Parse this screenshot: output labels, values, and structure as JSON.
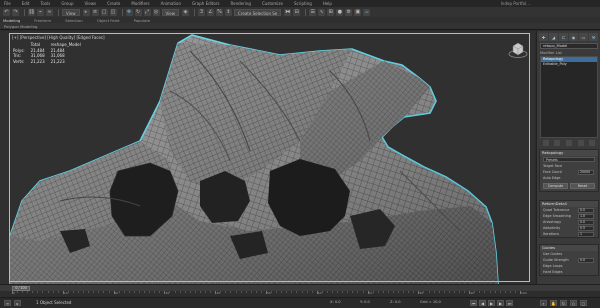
{
  "window": {
    "title": "Indep Portfol..."
  },
  "menu": [
    "File",
    "Edit",
    "Tools",
    "Group",
    "Views",
    "Create",
    "Modifiers",
    "Animation",
    "Graph Editors",
    "Rendering",
    "Customize",
    "Scripting",
    "Help"
  ],
  "toolbar": {
    "selection_set": "Create Selection Se",
    "view_mode": "View"
  },
  "ribbon": {
    "tabs": [
      "Modeling",
      "Freeform",
      "Selection",
      "Object Paint",
      "Populate"
    ],
    "sub_label": "Polygon Modeling"
  },
  "viewport": {
    "label": "[+] [Perspective] [High Quality] [Edged Faces]",
    "stats": {
      "headers": [
        "",
        "Total",
        "reshape_Model"
      ],
      "rows": [
        [
          "Polys:",
          "21,484",
          "21,484"
        ],
        [
          "Tris:",
          "31,068",
          "31,068"
        ],
        [
          "Verts:",
          "21,223",
          "21,223"
        ]
      ]
    }
  },
  "command_panel": {
    "object_name": "retopo_Model",
    "modifier_list_label": "Modifier List",
    "stack": [
      {
        "label": "Retopology",
        "selected": true
      },
      {
        "label": "Editable_Poly",
        "selected": false
      }
    ],
    "retopology": {
      "title": "Retopology",
      "preset": "Presets",
      "target_label": "Target Face",
      "face_count_label": "Face Count",
      "face_count": "20000",
      "auto_edge_label": "Auto Edge",
      "compute_button": "Compute",
      "reset_button": "Reset",
      "settings_title": "ReformDetail",
      "settings": [
        {
          "label": "Quad Tolerance",
          "value": "0.0"
        },
        {
          "label": "Edge Smoothing",
          "value": "1.0"
        },
        {
          "label": "Anisotropy",
          "value": "0.0"
        },
        {
          "label": "Adaptivity",
          "value": "0.5"
        },
        {
          "label": "Iterations",
          "value": "1"
        }
      ],
      "guides_title": "Guides",
      "guides": [
        {
          "label": "Use Guides",
          "value": ""
        },
        {
          "label": "Guide Strength",
          "value": "0.0"
        },
        {
          "label": "Edge Loops",
          "value": ""
        },
        {
          "label": "Hard Edges",
          "value": ""
        }
      ]
    }
  },
  "timeline": {
    "frame": "0 / 100",
    "ticks": [
      "0",
      "10",
      "20",
      "30",
      "40",
      "50",
      "60",
      "70",
      "80",
      "90",
      "100"
    ]
  },
  "status": {
    "message": "1 Object Selected",
    "x": "X: 0.0",
    "y": "Y: 0.0",
    "z": "Z: 0.0",
    "grid": "Grid = 10.0"
  },
  "colors": {
    "selection_outline": "#5fd4e8",
    "viewport_border": "#e0c040",
    "panel": "#3a3a3a",
    "modifier_selected": "#3d6e9b"
  }
}
